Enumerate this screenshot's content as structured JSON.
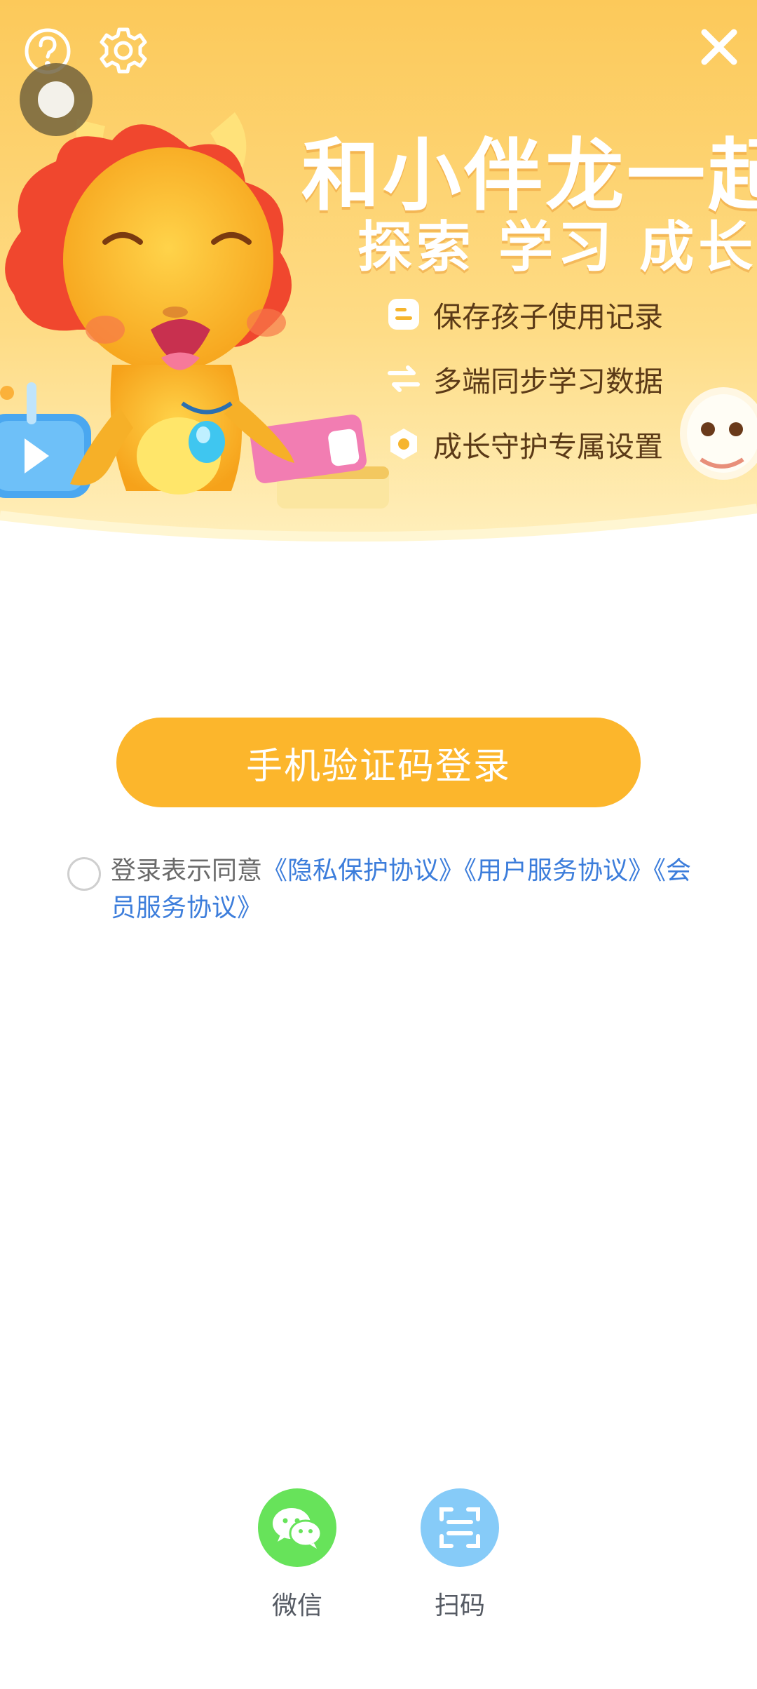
{
  "banner": {
    "title_line1": "和小伴龙一起",
    "title_line2": "探索 学习 成长",
    "features": [
      {
        "icon": "record-icon",
        "label": "保存孩子使用记录"
      },
      {
        "icon": "sync-arrows-icon",
        "label": "多端同步学习数据"
      },
      {
        "icon": "shield-hex-icon",
        "label": "成长守护专属设置"
      }
    ],
    "accent_color": "#fcb62c",
    "background_colors": [
      "#fcd36a",
      "#ffe9a6"
    ]
  },
  "topbar": {
    "help_icon": "question-circle-icon",
    "settings_icon": "gear-icon",
    "close_icon": "close-icon"
  },
  "login": {
    "button_label": "手机验证码登录"
  },
  "agreement": {
    "prefix": "登录表示同意",
    "privacy_link": "《隐私保护协议》",
    "user_link": "《用户服务协议》",
    "member_link": "《会员服务协议》",
    "checked": false
  },
  "alt_login": {
    "options": [
      {
        "label": "微信",
        "icon": "wechat-icon",
        "color": "#67e35a"
      },
      {
        "label": "扫码",
        "icon": "scan-icon",
        "color": "#86cbf8"
      }
    ]
  }
}
